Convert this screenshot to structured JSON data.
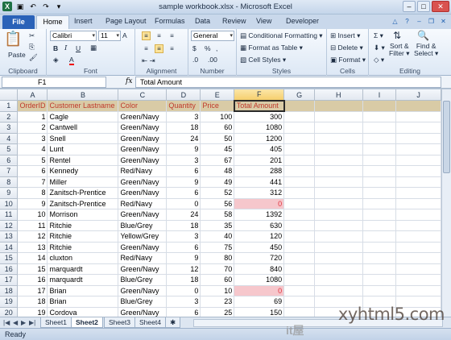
{
  "window": {
    "title": "sample workbook.xlsx - Microsoft Excel",
    "controls": [
      "minimize",
      "maximize",
      "close"
    ]
  },
  "ribbon_tabs": [
    "File",
    "Home",
    "Insert",
    "Page Layout",
    "Formulas",
    "Data",
    "Review",
    "View",
    "Developer"
  ],
  "ribbon": {
    "clipboard": {
      "label": "Clipboard",
      "paste": "Paste"
    },
    "font": {
      "label": "Font",
      "name": "Calibri",
      "size": "11"
    },
    "alignment": {
      "label": "Alignment"
    },
    "number": {
      "label": "Number",
      "format": "General",
      "currency": "$",
      "percent": "%"
    },
    "styles": {
      "label": "Styles",
      "conditional": "Conditional Formatting",
      "format_table": "Format as Table",
      "cell_styles": "Cell Styles"
    },
    "cells": {
      "label": "Cells",
      "insert": "Insert",
      "delete": "Delete",
      "format": "Format"
    },
    "editing": {
      "label": "Editing",
      "sort1": "Sort &",
      "sort2": "Filter",
      "find1": "Find &",
      "find2": "Select"
    }
  },
  "formula_bar": {
    "name_box": "F1",
    "fx": "fx",
    "content": "Total Amount"
  },
  "columns": [
    "A",
    "B",
    "C",
    "D",
    "E",
    "F",
    "G",
    "H",
    "I",
    "J"
  ],
  "rows": [
    [
      "OrderID",
      "Customer Lastname",
      "Color",
      "Quantity",
      "Price",
      "Total Amount"
    ],
    [
      "1",
      "Cagle",
      "Green/Navy",
      "3",
      "100",
      "300"
    ],
    [
      "2",
      "Cantwell",
      "Green/Navy",
      "18",
      "60",
      "1080"
    ],
    [
      "3",
      "Snell",
      "Green/Navy",
      "24",
      "50",
      "1200"
    ],
    [
      "4",
      "Lunt",
      "Green/Navy",
      "9",
      "45",
      "405"
    ],
    [
      "5",
      "Rentel",
      "Green/Navy",
      "3",
      "67",
      "201"
    ],
    [
      "6",
      "Kennedy",
      "Red/Navy",
      "6",
      "48",
      "288"
    ],
    [
      "7",
      "Miller",
      "Green/Navy",
      "9",
      "49",
      "441"
    ],
    [
      "8",
      "Zanitsch-Prentice",
      "Green/Navy",
      "6",
      "52",
      "312"
    ],
    [
      "9",
      "Zanitsch-Prentice",
      "Red/Navy",
      "0",
      "56",
      "0"
    ],
    [
      "10",
      "Morrison",
      "Green/Navy",
      "24",
      "58",
      "1392"
    ],
    [
      "11",
      "Ritchie",
      "Blue/Grey",
      "18",
      "35",
      "630"
    ],
    [
      "12",
      "Ritchie",
      "Yellow/Grey",
      "3",
      "40",
      "120"
    ],
    [
      "13",
      "Ritchie",
      "Green/Navy",
      "6",
      "75",
      "450"
    ],
    [
      "14",
      "cluxton",
      "Red/Navy",
      "9",
      "80",
      "720"
    ],
    [
      "15",
      "marquardt",
      "Green/Navy",
      "12",
      "70",
      "840"
    ],
    [
      "16",
      "marquardt",
      "Blue/Grey",
      "18",
      "60",
      "1080"
    ],
    [
      "17",
      "Brian",
      "Green/Navy",
      "0",
      "10",
      "0"
    ],
    [
      "18",
      "Brian",
      "Blue/Grey",
      "3",
      "23",
      "69"
    ],
    [
      "19",
      "Cordova",
      "Green/Navy",
      "6",
      "25",
      "150"
    ]
  ],
  "sheets": [
    "Sheet1",
    "Sheet2",
    "Sheet3",
    "Sheet4"
  ],
  "active_sheet": "Sheet2",
  "status": "Ready",
  "watermark": {
    "main": "xyhtml5.com",
    "sub": "it屋"
  },
  "colors": {
    "header_fill": "#d9cba6",
    "header_text": "#c0392b",
    "zero_fill": "#f6c7cc",
    "zero_text": "#e0343f"
  }
}
